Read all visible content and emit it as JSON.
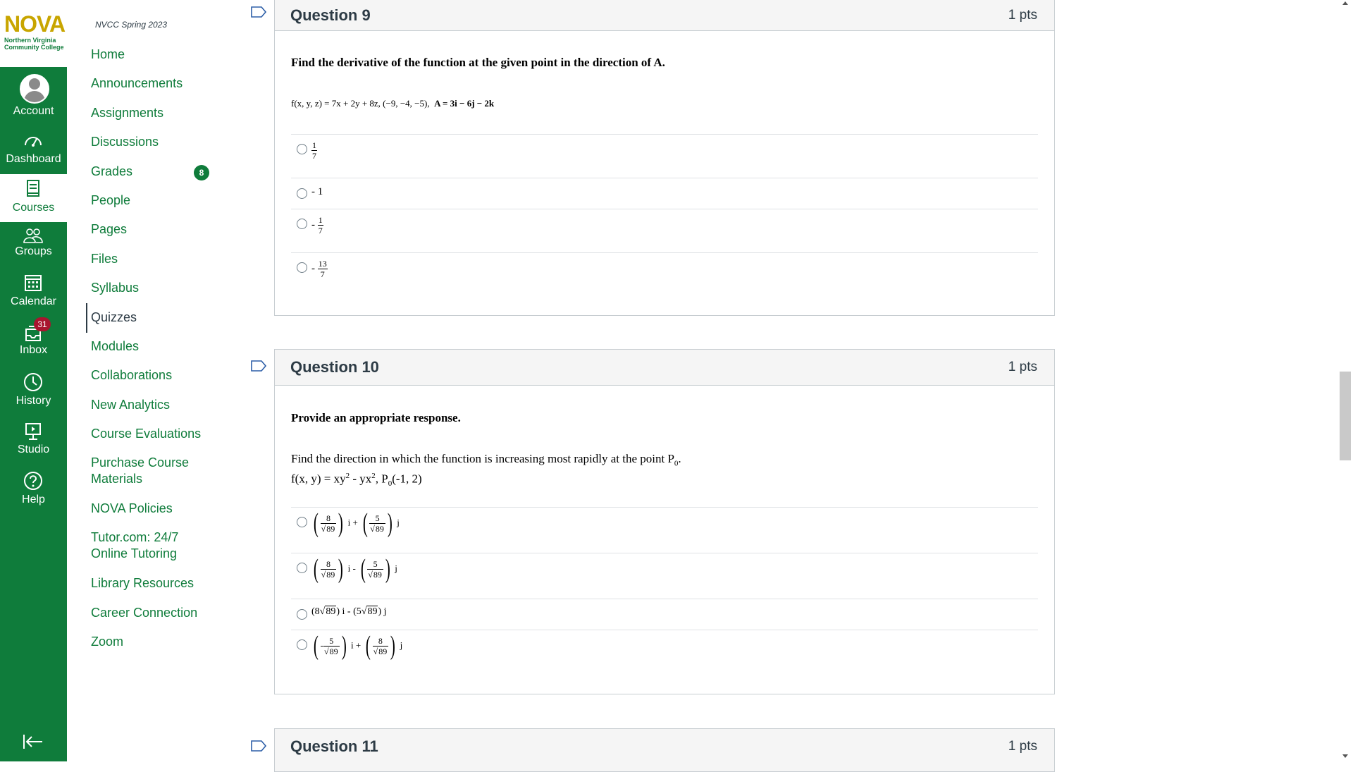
{
  "global_nav": {
    "logo_text": "NOVA",
    "logo_subtitle": "Northern Virginia Community College",
    "items": [
      {
        "label": "Account",
        "icon": "user-avatar-icon"
      },
      {
        "label": "Dashboard",
        "icon": "dashboard-gauge-icon"
      },
      {
        "label": "Courses",
        "icon": "book-icon"
      },
      {
        "label": "Groups",
        "icon": "groups-icon"
      },
      {
        "label": "Calendar",
        "icon": "calendar-icon"
      },
      {
        "label": "Inbox",
        "icon": "inbox-icon",
        "badge": "31"
      },
      {
        "label": "History",
        "icon": "clock-icon"
      },
      {
        "label": "Studio",
        "icon": "studio-icon"
      },
      {
        "label": "Help",
        "icon": "help-icon"
      }
    ],
    "active": "Courses",
    "colors": {
      "nav_bg": "#0f7c3b",
      "badge": "#a8152f",
      "logo_gold": "#c8a500"
    }
  },
  "course_nav": {
    "term": "NVCC Spring 2023",
    "items": [
      {
        "label": "Home"
      },
      {
        "label": "Announcements"
      },
      {
        "label": "Assignments"
      },
      {
        "label": "Discussions"
      },
      {
        "label": "Grades",
        "badge": "8"
      },
      {
        "label": "People"
      },
      {
        "label": "Pages"
      },
      {
        "label": "Files"
      },
      {
        "label": "Syllabus"
      },
      {
        "label": "Quizzes"
      },
      {
        "label": "Modules"
      },
      {
        "label": "Collaborations"
      },
      {
        "label": "New Analytics"
      },
      {
        "label": "Course Evaluations"
      },
      {
        "label": "Purchase Course Materials"
      },
      {
        "label": "NOVA Policies"
      },
      {
        "label": "Tutor.com: 24/7 Online Tutoring"
      },
      {
        "label": "Library Resources"
      },
      {
        "label": "Career Connection"
      },
      {
        "label": "Zoom"
      }
    ],
    "active": "Quizzes"
  },
  "questions": [
    {
      "title": "Question 9",
      "points": "1 pts",
      "prompt": "Find the derivative of the function at the given point in the direction of A.",
      "equation": "f(x, y, z) = 7x + 2y + 8z,  (−9, −4, −5),",
      "equation_bold": "A = 3i − 6j − 2k",
      "answers": [
        {
          "sign": "",
          "num": "1",
          "den": "7"
        },
        {
          "text": "- 1"
        },
        {
          "sign": "- ",
          "num": "1",
          "den": "7"
        },
        {
          "sign": "- ",
          "num": "13",
          "den": "7"
        }
      ]
    },
    {
      "title": "Question 10",
      "points": "1 pts",
      "prompt": "Provide an appropriate response.",
      "stem": "Find the direction in which the function is increasing most rapidly at the point P",
      "stem_sub": "0",
      "stem_end": ".",
      "function_line": {
        "a": "f(x, y) = xy",
        "sup1": "2",
        "b": " - yx",
        "sup2": "2",
        "c": ", P",
        "sub": "0",
        "d": "(-1, 2)"
      },
      "answers": [
        {
          "a_sign": "",
          "a_num": "8",
          "op": "i +",
          "b_sign": "",
          "b_num": "5",
          "root": "89",
          "tail": "j"
        },
        {
          "a_sign": "",
          "a_num": "8",
          "op": "i -",
          "b_sign": "",
          "b_num": "5",
          "root": "89",
          "tail": "j"
        },
        {
          "plain": true,
          "a": "8",
          "op": "i -",
          "b": "5",
          "root": "89",
          "tail": "j"
        },
        {
          "a_sign": "-",
          "a_num": "5",
          "op": "i +",
          "b_sign": "",
          "b_num": "8",
          "root": "89",
          "tail": "j"
        }
      ]
    },
    {
      "title": "Question 11",
      "points": "1 pts"
    }
  ]
}
